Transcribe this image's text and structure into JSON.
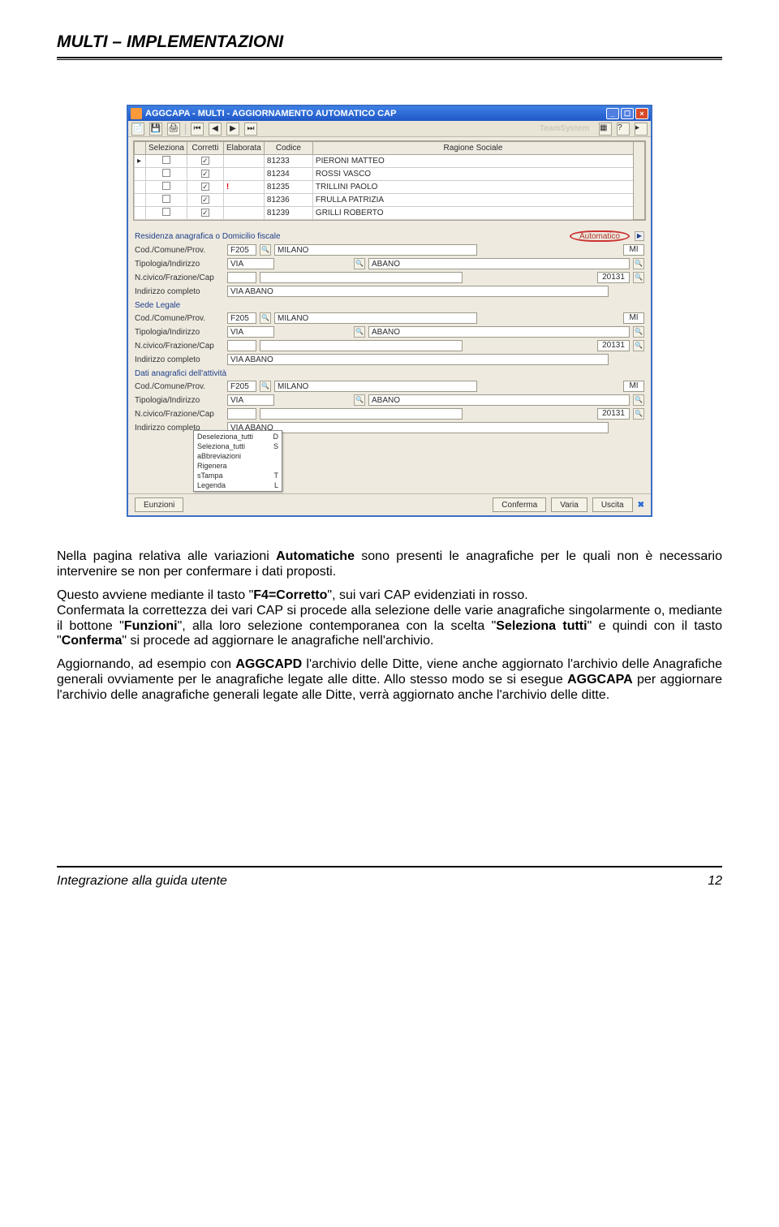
{
  "doc": {
    "header": "MULTI – IMPLEMENTAZIONI",
    "footer_left": "Integrazione alla guida utente",
    "footer_right": "12"
  },
  "win": {
    "title": "AGGCAPA - MULTI - AGGIORNAMENTO AUTOMATICO CAP",
    "logo": "TeamSystem",
    "grid": {
      "headers": [
        "Seleziona",
        "Corretti",
        "Elaborata",
        "Codice",
        "Ragione Sociale"
      ],
      "rows": [
        {
          "sel": false,
          "cor": true,
          "ela": "",
          "cod": "81233",
          "rag": "PIERONI MATTEO"
        },
        {
          "sel": false,
          "cor": true,
          "ela": "",
          "cod": "81234",
          "rag": "ROSSI VASCO"
        },
        {
          "sel": false,
          "cor": true,
          "ela": "!",
          "cod": "81235",
          "rag": "TRILLINI PAOLO"
        },
        {
          "sel": false,
          "cor": true,
          "ela": "",
          "cod": "81236",
          "rag": "FRULLA PATRIZIA"
        },
        {
          "sel": false,
          "cor": true,
          "ela": "",
          "cod": "81239",
          "rag": "GRILLI ROBERTO"
        }
      ]
    },
    "sections": [
      {
        "title": "Residenza anagrafica o Domicilio fiscale",
        "auto": "Automatico",
        "rows": "address"
      },
      {
        "title": "Sede Legale",
        "rows": "address"
      },
      {
        "title": "Dati anagrafici dell'attività",
        "rows": "address"
      }
    ],
    "addr": {
      "cod_label": "Cod./Comune/Prov.",
      "cod": "F205",
      "comune": "MILANO",
      "prov": "MI",
      "tip_label": "Tipologia/Indirizzo",
      "tip": "VIA",
      "via": "ABANO",
      "civ_label": "N.civico/Frazione/Cap",
      "cap": "20131",
      "full_label": "Indirizzo completo",
      "full": "VIA ABANO"
    },
    "popup": [
      {
        "t": "Deseleziona_tutti",
        "k": "D"
      },
      {
        "t": "Seleziona_tutti",
        "k": "S"
      },
      {
        "t": "aBbreviazioni",
        "k": ""
      },
      {
        "t": "Rigenera",
        "k": ""
      },
      {
        "t": "sTampa",
        "k": "T"
      },
      {
        "t": "Legenda",
        "k": "L"
      }
    ],
    "bottom": {
      "funzioni": "Eunzioni",
      "conferma": "Conferma",
      "varia": "Varia",
      "uscita": "Uscita"
    }
  },
  "para": {
    "p1a": "Nella pagina relativa alle variazioni ",
    "p1b": "Automatiche",
    "p1c": " sono presenti le anagrafiche per le quali non è necessario intervenire se non per confermare i dati proposti.",
    "p2a": "Questo avviene mediante il tasto \"",
    "p2b": "F4=Corretto",
    "p2c": "\", sui vari CAP evidenziati in rosso.",
    "p3a": "Confermata la correttezza dei vari CAP si procede alla selezione delle varie anagrafiche singolarmente o, mediante il bottone \"",
    "p3b": "Funzioni",
    "p3c": "\", alla loro selezione contemporanea con la scelta \"",
    "p3d": "Seleziona tutti",
    "p3e": "\" e quindi con il tasto \"",
    "p3f": "Conferma",
    "p3g": "\" si procede ad aggiornare le anagrafiche nell'archivio.",
    "p4a": "Aggiornando, ad esempio con ",
    "p4b": "AGGCAPD",
    "p4c": " l'archivio delle Ditte, viene anche aggiornato l'archivio delle Anagrafiche generali ovviamente per le anagrafiche legate alle ditte. Allo stesso modo se si esegue ",
    "p4d": "AGGCAPA",
    "p4e": " per aggiornare l'archivio delle anagrafiche generali legate alle Ditte, verrà aggiornato anche l'archivio delle ditte."
  }
}
